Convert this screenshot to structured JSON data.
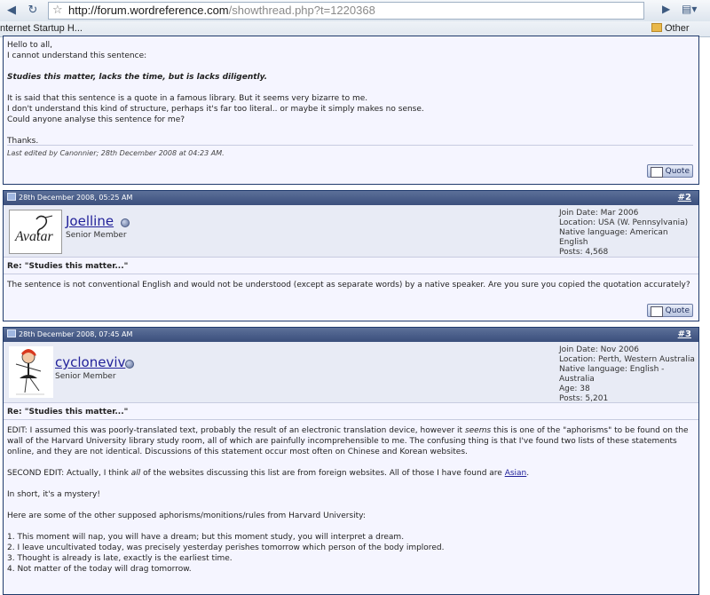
{
  "browser": {
    "url_host": "http://forum.wordreference.com",
    "url_path": "/showthread.php?t=1220368",
    "bookmark_left": "nternet Startup H...",
    "bookmark_right": "Other bookm"
  },
  "post1": {
    "greeting": "Hello to all,",
    "line1": "I cannot understand this sentence:",
    "quote": "Studies this matter, lacks the time, but is lacks diligently.",
    "line2": "It is said that this sentence is a quote in a famous library. But it seems very bizarre to me.",
    "line3": "I don't understand this kind of structure, perhaps it's far too literal.. or maybe it simply makes no sense.",
    "line4": "Could anyone analyse this sentence for me?",
    "thanks": "Thanks.",
    "edited": "Last edited by Canonnier; 28th December 2008 at 04:23 AM.",
    "quote_label": "Quote"
  },
  "post2": {
    "date": "28th December 2008, 05:25 AM",
    "number": "#2",
    "avatar_text": "Avatar",
    "username": "Joelline",
    "user_title": "Senior Member",
    "join_date": "Join Date: Mar 2006",
    "location": "Location: USA (W. Pennsylvania)",
    "native_language": "Native language: American English",
    "posts": "Posts: 4,568",
    "title": "Re: \"Studies this matter...\"",
    "body": "The sentence is not conventional English and would not be understood (except as separate words) by a native speaker. Are you sure you copied the quotation accurately?",
    "quote_label": "Quote"
  },
  "post3": {
    "date": "28th December 2008, 07:45 AM",
    "number": "#3",
    "username": "cycloneviv",
    "user_title": "Senior Member",
    "join_date": "Join Date: Nov 2006",
    "location": "Location: Perth, Western Australia",
    "native_language": "Native language: English - Australia",
    "age": "Age: 38",
    "posts": "Posts: 5,201",
    "title": "Re: \"Studies this matter...\"",
    "edit1_a": "EDIT: I assumed this was poorly-translated text, probably the result of an electronic translation device, however it ",
    "edit1_em": "seems",
    "edit1_b": " this is one of the \"aphorisms\" to be found on the wall of the Harvard University library study room, all of which are painfully incomprehensible to me. The confusing thing is that I've found two lists of these statements online, and they are not identical. Discussions of this statement occur most often on Chinese and Korean websites.",
    "edit2_a": "SECOND EDIT: Actually, I think ",
    "edit2_em": "all",
    "edit2_b": " of the websites discussing this list are from foreign websites. All of those I have found are ",
    "edit2_link": "Asian",
    "edit2_c": ".",
    "mystery": "In short, it's a mystery!",
    "intro": "Here are some of the other supposed aphorisms/monitions/rules from Harvard University:",
    "list": [
      "1. This moment will nap, you will have a dream; but this moment study, you will interpret a dream.",
      "2. I leave uncultivated today, was precisely yesterday perishes tomorrow which person of the body implored.",
      "3. Thought is already is late, exactly is the earliest time.",
      "4. Not matter of the today will drag tomorrow."
    ]
  }
}
